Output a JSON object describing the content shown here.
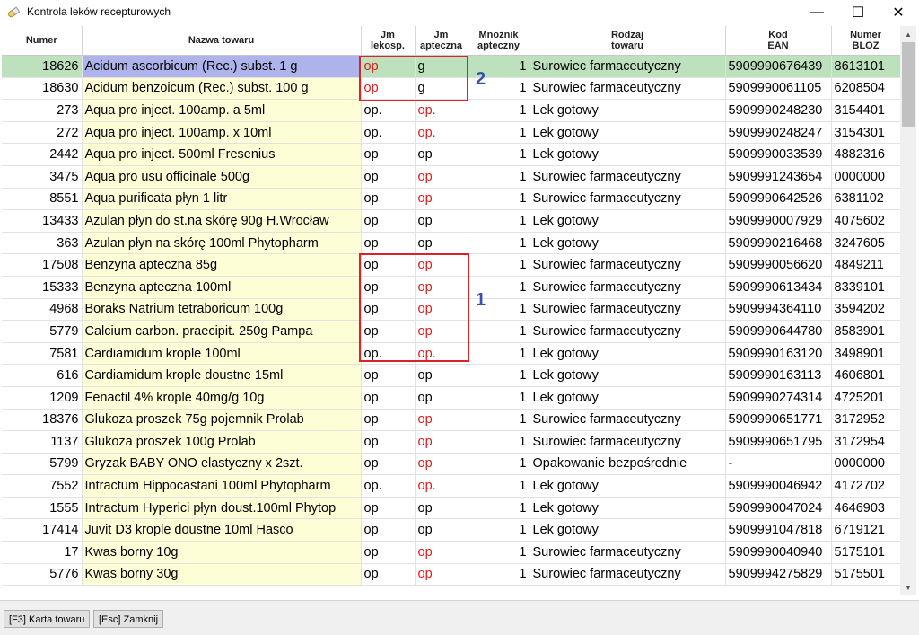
{
  "window": {
    "title": "Kontrola leków recepturowych",
    "minimize": "—",
    "maximize": "☐",
    "close": "✕"
  },
  "columns": {
    "numer": "Numer",
    "nazwa": "Nazwa towaru",
    "jm_lek_1": "Jm",
    "jm_lek_2": "lekosp.",
    "jm_apt_1": "Jm",
    "jm_apt_2": "apteczna",
    "mnoznik_1": "Mnożnik",
    "mnoznik_2": "apteczny",
    "rodzaj_1": "Rodzaj",
    "rodzaj_2": "towaru",
    "ean_1": "Kod",
    "ean_2": "EAN",
    "bloz_1": "Numer",
    "bloz_2": "BLOZ"
  },
  "rows": [
    {
      "numer": "18626",
      "nazwa": "Acidum ascorbicum (Rec.) subst. 1 g",
      "jm_lek": "op",
      "jm_apt": "g",
      "mnoznik": "1",
      "rodzaj": "Surowiec farmaceutyczny",
      "ean": "5909990676439",
      "bloz": "8613101",
      "red_lek": true,
      "red_apt": false
    },
    {
      "numer": "18630",
      "nazwa": "Acidum benzoicum (Rec.) subst. 100 g",
      "jm_lek": "op",
      "jm_apt": "g",
      "mnoznik": "1",
      "rodzaj": "Surowiec farmaceutyczny",
      "ean": "5909990061105",
      "bloz": "6208504",
      "red_lek": true,
      "red_apt": false
    },
    {
      "numer": "273",
      "nazwa": "Aqua pro inject. 100amp. a  5ml",
      "jm_lek": "op.",
      "jm_apt": "op.",
      "mnoznik": "1",
      "rodzaj": "Lek gotowy",
      "ean": "5909990248230",
      "bloz": "3154401",
      "red_lek": false,
      "red_apt": true
    },
    {
      "numer": "272",
      "nazwa": "Aqua pro inject. 100amp. x 10ml",
      "jm_lek": "op.",
      "jm_apt": "op.",
      "mnoznik": "1",
      "rodzaj": "Lek gotowy",
      "ean": "5909990248247",
      "bloz": "3154301",
      "red_lek": false,
      "red_apt": true
    },
    {
      "numer": "2442",
      "nazwa": "Aqua pro inject. 500ml Fresenius",
      "jm_lek": "op",
      "jm_apt": "op",
      "mnoznik": "1",
      "rodzaj": "Lek gotowy",
      "ean": "5909990033539",
      "bloz": "4882316",
      "red_lek": false,
      "red_apt": false
    },
    {
      "numer": "3475",
      "nazwa": "Aqua pro usu officinale 500g",
      "jm_lek": "op",
      "jm_apt": "op",
      "mnoznik": "1",
      "rodzaj": "Surowiec farmaceutyczny",
      "ean": "5909991243654",
      "bloz": "0000000",
      "red_lek": false,
      "red_apt": true
    },
    {
      "numer": "8551",
      "nazwa": "Aqua purificata płyn 1 litr",
      "jm_lek": "op",
      "jm_apt": "op",
      "mnoznik": "1",
      "rodzaj": "Surowiec farmaceutyczny",
      "ean": "5909990642526",
      "bloz": "6381102",
      "red_lek": false,
      "red_apt": true
    },
    {
      "numer": "13433",
      "nazwa": "Azulan płyn do st.na skórę 90g H.Wrocław",
      "jm_lek": "op",
      "jm_apt": "op",
      "mnoznik": "1",
      "rodzaj": "Lek gotowy",
      "ean": "5909990007929",
      "bloz": "4075602",
      "red_lek": false,
      "red_apt": false
    },
    {
      "numer": "363",
      "nazwa": "Azulan płyn na skórę 100ml Phytopharm",
      "jm_lek": "op",
      "jm_apt": "op",
      "mnoznik": "1",
      "rodzaj": "Lek gotowy",
      "ean": "5909990216468",
      "bloz": "3247605",
      "red_lek": false,
      "red_apt": false
    },
    {
      "numer": "17508",
      "nazwa": "Benzyna apteczna  85g",
      "jm_lek": "op",
      "jm_apt": "op",
      "mnoznik": "1",
      "rodzaj": "Surowiec farmaceutyczny",
      "ean": "5909990056620",
      "bloz": "4849211",
      "red_lek": false,
      "red_apt": true
    },
    {
      "numer": "15333",
      "nazwa": "Benzyna apteczna 100ml",
      "jm_lek": "op",
      "jm_apt": "op",
      "mnoznik": "1",
      "rodzaj": "Surowiec farmaceutyczny",
      "ean": "5909990613434",
      "bloz": "8339101",
      "red_lek": false,
      "red_apt": true
    },
    {
      "numer": "4968",
      "nazwa": "Boraks Natrium tetraboricum 100g",
      "jm_lek": "op",
      "jm_apt": "op",
      "mnoznik": "1",
      "rodzaj": "Surowiec farmaceutyczny",
      "ean": "5909994364110",
      "bloz": "3594202",
      "red_lek": false,
      "red_apt": true
    },
    {
      "numer": "5779",
      "nazwa": "Calcium carbon. praecipit. 250g Pampa",
      "jm_lek": "op",
      "jm_apt": "op",
      "mnoznik": "1",
      "rodzaj": "Surowiec farmaceutyczny",
      "ean": "5909990644780",
      "bloz": "8583901",
      "red_lek": false,
      "red_apt": true
    },
    {
      "numer": "7581",
      "nazwa": "Cardiamidum krople 100ml",
      "jm_lek": "op.",
      "jm_apt": "op.",
      "mnoznik": "1",
      "rodzaj": "Lek gotowy",
      "ean": "5909990163120",
      "bloz": "3498901",
      "red_lek": false,
      "red_apt": true
    },
    {
      "numer": "616",
      "nazwa": "Cardiamidum krople doustne 15ml",
      "jm_lek": "op",
      "jm_apt": "op",
      "mnoznik": "1",
      "rodzaj": "Lek gotowy",
      "ean": "5909990163113",
      "bloz": "4606801",
      "red_lek": false,
      "red_apt": false
    },
    {
      "numer": "1209",
      "nazwa": "Fenactil 4% krople 40mg/g  10g",
      "jm_lek": "op",
      "jm_apt": "op",
      "mnoznik": "1",
      "rodzaj": "Lek gotowy",
      "ean": "5909990274314",
      "bloz": "4725201",
      "red_lek": false,
      "red_apt": false
    },
    {
      "numer": "18376",
      "nazwa": "Glukoza proszek  75g pojemnik Prolab",
      "jm_lek": "op",
      "jm_apt": "op",
      "mnoznik": "1",
      "rodzaj": "Surowiec farmaceutyczny",
      "ean": "5909990651771",
      "bloz": "3172952",
      "red_lek": false,
      "red_apt": true
    },
    {
      "numer": "1137",
      "nazwa": "Glukoza proszek 100g Prolab",
      "jm_lek": "op",
      "jm_apt": "op",
      "mnoznik": "1",
      "rodzaj": "Surowiec farmaceutyczny",
      "ean": "5909990651795",
      "bloz": "3172954",
      "red_lek": false,
      "red_apt": true
    },
    {
      "numer": "5799",
      "nazwa": "Gryzak BABY ONO elastyczny x 2szt.",
      "jm_lek": "op",
      "jm_apt": "op",
      "mnoznik": "1",
      "rodzaj": "Opakowanie bezpośrednie",
      "ean": "-",
      "bloz": "0000000",
      "red_lek": false,
      "red_apt": true
    },
    {
      "numer": "7552",
      "nazwa": "Intractum Hippocastani 100ml Phytopharm",
      "jm_lek": "op.",
      "jm_apt": "op.",
      "mnoznik": "1",
      "rodzaj": "Lek gotowy",
      "ean": "5909990046942",
      "bloz": "4172702",
      "red_lek": false,
      "red_apt": true
    },
    {
      "numer": "1555",
      "nazwa": "Intractum Hyperici płyn doust.100ml Phytop",
      "jm_lek": "op",
      "jm_apt": "op",
      "mnoznik": "1",
      "rodzaj": "Lek gotowy",
      "ean": "5909990047024",
      "bloz": "4646903",
      "red_lek": false,
      "red_apt": false
    },
    {
      "numer": "17414",
      "nazwa": "Juvit D3 krople doustne 10ml Hasco",
      "jm_lek": "op",
      "jm_apt": "op",
      "mnoznik": "1",
      "rodzaj": "Lek gotowy",
      "ean": "5909991047818",
      "bloz": "6719121",
      "red_lek": false,
      "red_apt": false
    },
    {
      "numer": "17",
      "nazwa": "Kwas borny 10g",
      "jm_lek": "op",
      "jm_apt": "op",
      "mnoznik": "1",
      "rodzaj": "Surowiec farmaceutyczny",
      "ean": "5909990040940",
      "bloz": "5175101",
      "red_lek": false,
      "red_apt": true
    },
    {
      "numer": "5776",
      "nazwa": "Kwas borny 30g",
      "jm_lek": "op",
      "jm_apt": "op",
      "mnoznik": "1",
      "rodzaj": "Surowiec farmaceutyczny",
      "ean": "5909994275829",
      "bloz": "5175501",
      "red_lek": false,
      "red_apt": true
    }
  ],
  "selected_row": 0,
  "annotations": {
    "label_1": "1",
    "label_2": "2"
  },
  "colors": {
    "selected_row": "#bde0bd",
    "selected_name_cell": "#aeb3ec",
    "name_column": "#fdfdd6",
    "red_text": "#e21b1b",
    "annotation_box": "#d9222a",
    "annotation_label": "#3a4fb0"
  },
  "buttons": {
    "karta": "[F3] Karta towaru",
    "zamknij": "[Esc] Zamknij"
  }
}
